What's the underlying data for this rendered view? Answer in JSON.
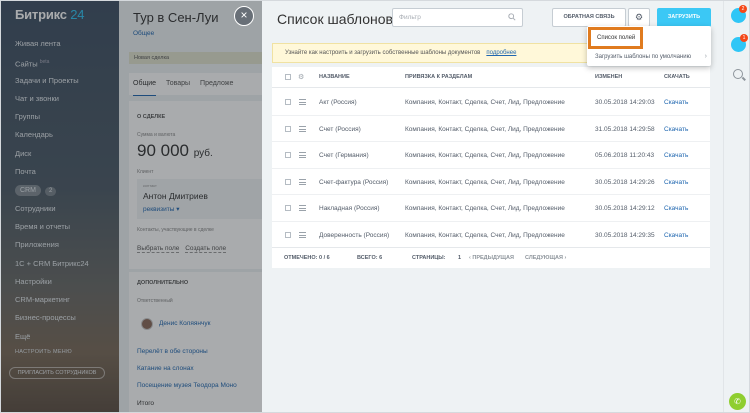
{
  "sidebar": {
    "logo": "Битрикс",
    "logo_num": "24",
    "items": [
      {
        "label": "Живая лента"
      },
      {
        "label": "Сайты",
        "sup": "beta"
      },
      {
        "label": "Задачи и Проекты"
      },
      {
        "label": "Чат и звонки"
      },
      {
        "label": "Группы"
      },
      {
        "label": "Календарь"
      },
      {
        "label": "Диск"
      },
      {
        "label": "Почта"
      },
      {
        "label": "CRM",
        "count": "2"
      },
      {
        "label": "Сотрудники"
      },
      {
        "label": "Время и отчеты"
      },
      {
        "label": "Приложения"
      },
      {
        "label": "1С + CRM Битрикс24"
      },
      {
        "label": "Настройки"
      },
      {
        "label": "CRM-маркетинг"
      },
      {
        "label": "Бизнес-процессы"
      },
      {
        "label": "Ещё"
      }
    ],
    "settings": "НАСТРОИТЬ МЕНЮ",
    "invite": "ПРИГЛАСИТЬ СОТРУДНИКОВ"
  },
  "deal": {
    "title": "Тур в Сен-Луи",
    "subtitle": "Общее",
    "stage": "Новая сделка",
    "tabs": [
      "Общие",
      "Товары",
      "Предложе"
    ],
    "about_header": "О СДЕЛКЕ",
    "sum_label": "Сумма и валюта",
    "sum_value": "90 000",
    "sum_currency": "руб.",
    "client_label": "Клиент",
    "client_small": "контакт",
    "client_name": "Антон Дмитриев",
    "client_requisites": "реквизиты",
    "client_note": "Контакты, участвующие в сделке",
    "link_choose": "Выбрать поле",
    "link_create": "Создать поле",
    "extra_header": "ДОПОЛНИТЕЛЬНО",
    "responsible_label": "Ответственный",
    "responsible_name": "Денис Коляянчук",
    "links": [
      "Перелёт в обе стороны",
      "Катание на слонах",
      "Посещение музея Теодора Моно"
    ],
    "total": "Итого"
  },
  "templates": {
    "title": "Список шаблонов",
    "filter_placeholder": "Фильтр",
    "btn_feedback": "ОБРАТНАЯ СВЯЗЬ",
    "btn_upload": "ЗАГРУЗИТЬ",
    "info_text": "Узнайте как настроить и загрузить собственные шаблоны документов",
    "info_more": "подробнее",
    "columns": [
      "НАЗВАНИЕ",
      "ПРИВЯЗКА К РАЗДЕЛАМ",
      "ИЗМЕНЕН",
      "СКАЧАТЬ"
    ],
    "rows": [
      {
        "name": "Акт (Россия)",
        "bind": "Компания, Контакт, Сделка, Счет, Лид, Предложение",
        "date": "30.05.2018 14:29:03",
        "download": "Скачать"
      },
      {
        "name": "Счет (Россия)",
        "bind": "Компания, Контакт, Сделка, Счет, Лид, Предложение",
        "date": "31.05.2018 14:29:58",
        "download": "Скачать"
      },
      {
        "name": "Счет (Германия)",
        "bind": "Компания, Контакт, Сделка, Счет, Лид, Предложение",
        "date": "05.06.2018 11:20:43",
        "download": "Скачать"
      },
      {
        "name": "Счет-фактура (Россия)",
        "bind": "Компания, Контакт, Сделка, Счет, Лид, Предложение",
        "date": "30.05.2018 14:29:26",
        "download": "Скачать"
      },
      {
        "name": "Накладная (Россия)",
        "bind": "Компания, Контакт, Сделка, Счет, Лид, Предложение",
        "date": "30.05.2018 14:29:12",
        "download": "Скачать"
      },
      {
        "name": "Доверенность (Россия)",
        "bind": "Компания, Контакт, Сделка, Счет, Лид, Предложение",
        "date": "30.05.2018 14:29:35",
        "download": "Скачать"
      }
    ],
    "footer": {
      "selected": "ОТМЕЧЕНО: 0 / 6",
      "total": "ВСЕГО: 6",
      "pages_label": "СТРАНИЦЫ:",
      "page": "1",
      "prev": "ПРЕДЫДУЩАЯ",
      "next": "СЛЕДУЮЩАЯ"
    },
    "dropdown": {
      "item1": "Список полей",
      "item2": "Загрузить шаблоны по умолчанию"
    }
  },
  "rail": {
    "badge1": "2",
    "badge2": "1"
  },
  "colors": {
    "accent": "#3bc8f5",
    "link": "#2067b0",
    "highlight": "#e07b1f"
  }
}
